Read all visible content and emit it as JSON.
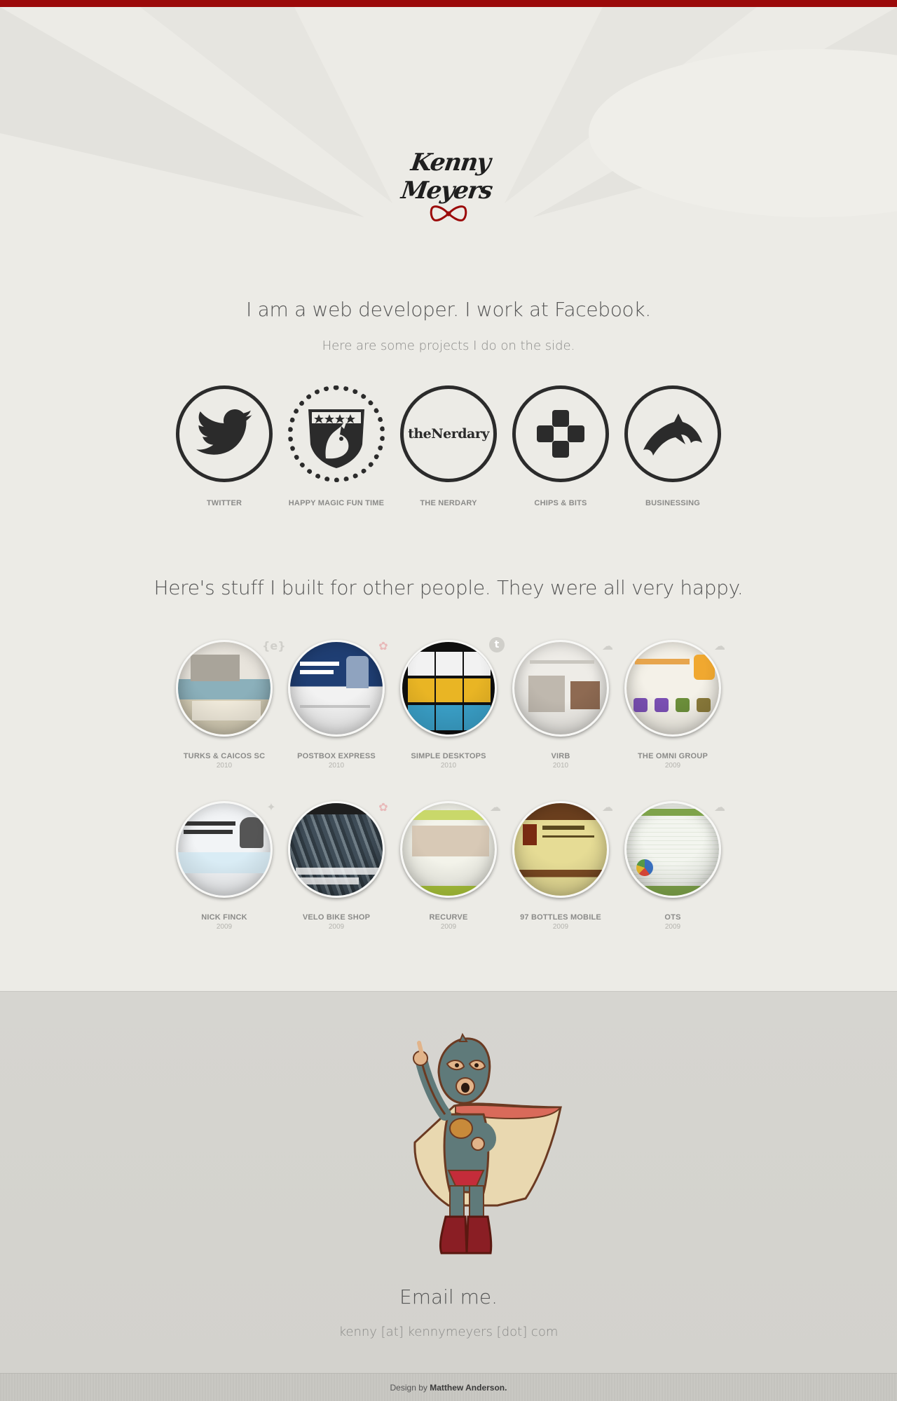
{
  "header": {
    "logo_text": "Kenny Meyers",
    "accent": "#9b0a0a"
  },
  "intro": {
    "headline": "I am a web developer. I work at Facebook.",
    "subline": "Here are some projects I do on the side."
  },
  "side_projects": [
    {
      "label": "TWITTER",
      "icon": "twitter-bird-icon"
    },
    {
      "label": "HAPPY MAGIC FUN TIME",
      "icon": "unicorn-badge-icon"
    },
    {
      "label": "THE NERDARY",
      "icon": "thenerdary-wordmark",
      "wordmark": "theNerdary"
    },
    {
      "label": "CHIPS & BITS",
      "icon": "dpad-icon"
    },
    {
      "label": "BUSINESSING",
      "icon": "dolphin-icon"
    }
  ],
  "client_section_title": "Here's stuff I built for other people. They were all very happy.",
  "client_work": [
    {
      "label": "TURKS & CAICOS SC",
      "year": "2010",
      "badge": "{e}",
      "color": "#b7c4c8"
    },
    {
      "label": "POSTBOX EXPRESS",
      "year": "2010",
      "badge": "✿",
      "color": "#23457e"
    },
    {
      "label": "SIMPLE DESKTOPS",
      "year": "2010",
      "badge": "t",
      "color": "#1a1a1a"
    },
    {
      "label": "VIRB",
      "year": "2010",
      "badge": "☁",
      "color": "#e9e7e2"
    },
    {
      "label": "THE OMNI GROUP",
      "year": "2009",
      "badge": "☁",
      "color": "#f3f0e8"
    },
    {
      "label": "NICK FINCK",
      "year": "2009",
      "badge": "✦",
      "color": "#dfe6ec"
    },
    {
      "label": "VELO BIKE SHOP",
      "year": "2009",
      "badge": "✿",
      "color": "#4b5a66"
    },
    {
      "label": "RECURVE",
      "year": "2009",
      "badge": "☁",
      "color": "#eef0e4"
    },
    {
      "label": "97 BOTTLES MOBILE",
      "year": "2009",
      "badge": "☁",
      "color": "#d8cf8e"
    },
    {
      "label": "OTS",
      "year": "2009",
      "badge": "☁",
      "color": "#eef1ea"
    }
  ],
  "contact": {
    "title": "Email me.",
    "address": "kenny [at] kennymeyers [dot] com"
  },
  "footer": {
    "credit_prefix": "Design by",
    "credit_name": "Matthew Anderson."
  }
}
